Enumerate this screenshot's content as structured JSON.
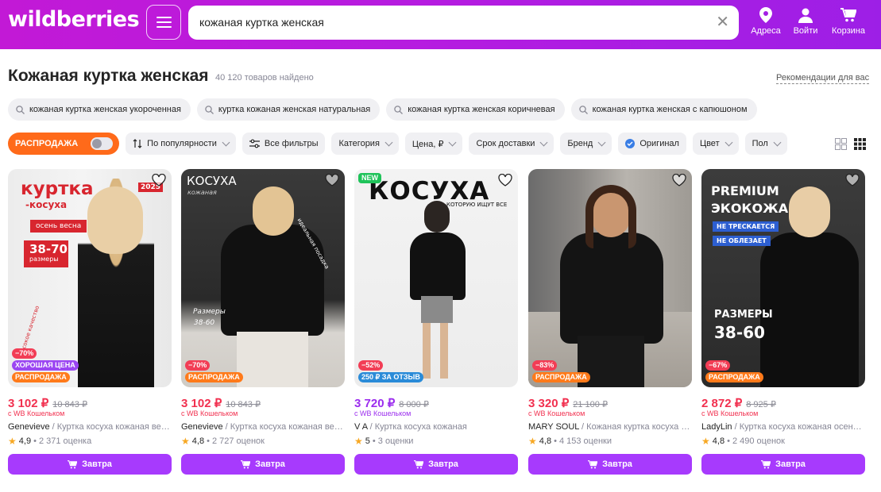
{
  "header": {
    "logo": "wildberries",
    "search_value": "кожаная куртка женская",
    "nav": [
      {
        "label": "Адреса",
        "icon": "location-pin-icon"
      },
      {
        "label": "Войти",
        "icon": "user-icon"
      },
      {
        "label": "Корзина",
        "icon": "cart-icon"
      }
    ]
  },
  "results": {
    "title": "Кожаная куртка женская",
    "count": "40 120 товаров найдено",
    "recommendations_link": "Рекомендации для вас"
  },
  "suggestions": [
    "кожаная куртка женская укороченная",
    "куртка кожаная женская натуральная",
    "кожаная куртка женская коричневая",
    "кожаная куртка женская с капюшоном"
  ],
  "filters": {
    "sale_label": "РАСПРОДАЖА",
    "sort_label": "По популярности",
    "all_filters_label": "Все фильтры",
    "category_label": "Категория",
    "price_label": "Цена, ₽",
    "delivery_label": "Срок доставки",
    "brand_label": "Бренд",
    "original_label": "Оригинал",
    "color_label": "Цвет",
    "gender_label": "Пол"
  },
  "products": [
    {
      "price": "3 102 ₽",
      "old_price": "10 843 ₽",
      "wallet": "с WB Кошельком",
      "brand": "Genevieve",
      "title": " / Куртка косуха кожаная весенняя",
      "rating": "4,9",
      "reviews": "• 2 371 оценка",
      "badges": [
        "−70%",
        "ХОРОШАЯ ЦЕНА",
        "РАСПРОДАЖА"
      ],
      "image_text": [
        "куртка",
        "-косуха",
        "осень весна",
        "38-70",
        "размеры",
        "2025",
        "высокое качество"
      ],
      "cart_label": "Завтра"
    },
    {
      "price": "3 102 ₽",
      "old_price": "10 843 ₽",
      "wallet": "с WB Кошельком",
      "brand": "Genevieve",
      "title": " / Куртка косуха кожаная весенняя",
      "rating": "4,8",
      "reviews": "• 2 727 оценок",
      "badges": [
        "−70%",
        "РАСПРОДАЖА"
      ],
      "image_text": [
        "КОСУХА",
        "кожаная",
        "Размеры",
        "38-60",
        "идеальная посадка"
      ],
      "cart_label": "Завтра"
    },
    {
      "price": "3 720 ₽",
      "old_price": "8 000 ₽",
      "wallet": "с WB Кошельком",
      "brand": "V A",
      "title": " / Куртка косуха кожаная",
      "rating": "5",
      "reviews": "• 3 оценки",
      "badges": [
        "NEW",
        "−52%",
        "250 ₽ ЗА ОТЗЫВ"
      ],
      "image_text": [
        "КОСУХА",
        "КОТОРУЮ ИЩУТ ВСЕ"
      ],
      "cart_label": "Завтра"
    },
    {
      "price": "3 320 ₽",
      "old_price": "21 100 ₽",
      "wallet": "с WB Кошельком",
      "brand": "MARY SOUL",
      "title": " / Кожаная куртка косуха больших размеров",
      "rating": "4,8",
      "reviews": "• 4 153 оценки",
      "badges": [
        "−83%",
        "РАСПРОДАЖА"
      ],
      "image_text": [],
      "cart_label": "Завтра"
    },
    {
      "price": "2 872 ₽",
      "old_price": "8 925 ₽",
      "wallet": "с WB Кошельком",
      "brand": "LadyLin",
      "title": " / Куртка косуха кожаная осенняя",
      "rating": "4,8",
      "reviews": "• 2 490 оценок",
      "badges": [
        "−67%",
        "РАСПРОДАЖА"
      ],
      "image_text": [
        "PREMIUM",
        "ЭКОКОЖА",
        "НЕ ТРЕСКАЕТСЯ",
        "НЕ ОБЛЕЗАЕТ",
        "РАЗМЕРЫ",
        "38-60"
      ],
      "cart_label": "Завтра"
    }
  ],
  "colors": {
    "brand_purple": "#a73afd",
    "sale_orange": "#ff6a1a",
    "price_red": "#f1304f"
  }
}
